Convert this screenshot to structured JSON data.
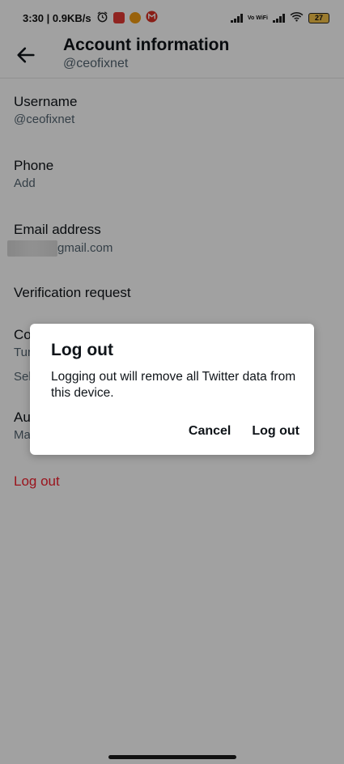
{
  "status_bar": {
    "time_speed": "3:30 | 0.9KB/s",
    "vowifi": "Vo WiFi",
    "battery": "27"
  },
  "header": {
    "title": "Account information",
    "handle": "@ceofixnet"
  },
  "list": {
    "username": {
      "label": "Username",
      "value": "@ceofixnet"
    },
    "phone": {
      "label": "Phone",
      "value": "Add"
    },
    "email": {
      "label": "Email address",
      "value": "gmail.com"
    },
    "verification": {
      "label": "Verification request"
    },
    "country": {
      "label": "Co",
      "value1": "Tur",
      "value2": "Sel"
    },
    "automation": {
      "label": "Au",
      "value": "Ma"
    },
    "logout": {
      "label": "Log out"
    }
  },
  "dialog": {
    "title": "Log out",
    "body": "Logging out will remove all Twitter data from this device.",
    "cancel_label": "Cancel",
    "confirm_label": "Log out"
  },
  "colors": {
    "danger": "#f4212e",
    "text_primary": "#0f1419",
    "text_secondary": "#536471",
    "scrim": "rgba(0,0,0,0.37)"
  },
  "icons": [
    "alarm-icon",
    "app-notification-icon",
    "gmail-icon",
    "signal-icon",
    "wifi-icon",
    "battery-icon",
    "back-arrow-icon"
  ]
}
